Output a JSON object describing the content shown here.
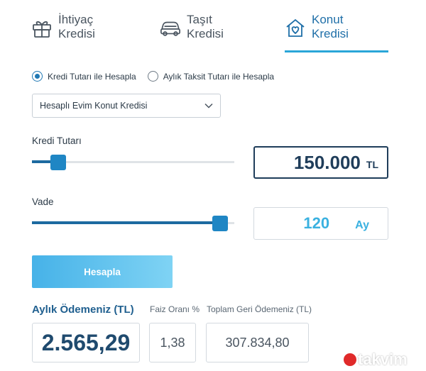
{
  "tabs": [
    {
      "line1": "İhtiyaç",
      "line2": "Kredisi",
      "icon": "gift-icon"
    },
    {
      "line1": "Taşıt",
      "line2": "Kredisi",
      "icon": "car-icon"
    },
    {
      "line1": "Konut",
      "line2": "Kredisi",
      "icon": "house-heart-icon",
      "active": true
    }
  ],
  "radio": {
    "option1": "Kredi Tutarı ile Hesapla",
    "option2": "Aylık Taksit Tutarı ile Hesapla",
    "selected": 0
  },
  "select": {
    "value": "Hesaplı Evim Konut Kredisi"
  },
  "kredi": {
    "label": "Kredi Tutarı",
    "value": "150.000",
    "unit": "TL",
    "slider_fraction": 0.07
  },
  "vade": {
    "label": "Vade",
    "value": "120",
    "unit": "Ay",
    "slider_fraction": 1.0
  },
  "button": {
    "label": "Hesapla"
  },
  "results": {
    "aylik_label": "Aylık Ödemeniz (TL)",
    "aylik_value": "2.565,29",
    "faiz_label": "Faiz Oranı %",
    "faiz_value": "1,38",
    "toplam_label": "Toplam Geri Ödemeniz (TL)",
    "toplam_value": "307.834,80"
  },
  "watermark": {
    "text": "takvim"
  },
  "colors": {
    "accent": "#1f86c4",
    "primary_dark": "#1f3d5a",
    "light_blue": "#3ab1e0",
    "underline": "#2aa6d8"
  }
}
